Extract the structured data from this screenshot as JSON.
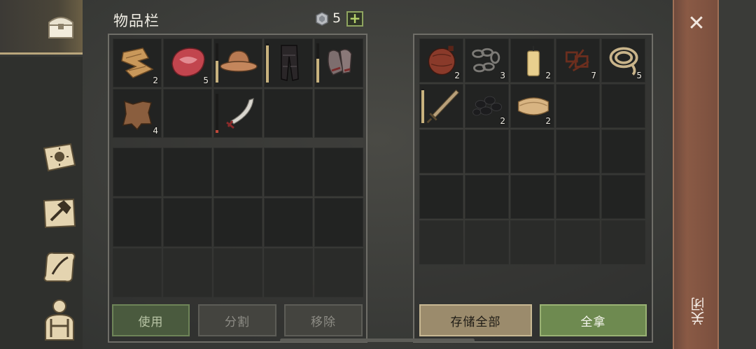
{
  "header": {
    "title": "物品栏",
    "gem_count": "5",
    "plus_label": "+"
  },
  "sidebar": {
    "items": [
      {
        "name": "chest-icon"
      },
      {
        "name": "sun-book-icon"
      },
      {
        "name": "hammer-map-icon"
      },
      {
        "name": "quill-scroll-icon"
      },
      {
        "name": "character-icon"
      }
    ]
  },
  "inventory": {
    "row1": [
      {
        "item": "cloth-scraps",
        "count": "2"
      },
      {
        "item": "raw-meat",
        "count": "5"
      },
      {
        "item": "iron-helmet",
        "count": "",
        "durability": 0.55
      },
      {
        "item": "leather-pants",
        "count": "",
        "durability": 0.95
      },
      {
        "item": "chainmail-gloves",
        "count": "",
        "durability": 0.6
      }
    ],
    "row2": [
      {
        "item": "animal-hide",
        "count": "4"
      },
      {
        "item": "",
        "count": ""
      },
      {
        "item": "scimitar",
        "count": "",
        "durability": 0.08
      },
      {
        "item": "",
        "count": ""
      },
      {
        "item": "",
        "count": ""
      }
    ]
  },
  "storage": {
    "row1": [
      {
        "item": "leather-flask",
        "count": "2"
      },
      {
        "item": "iron-chain",
        "count": "3"
      },
      {
        "item": "candle",
        "count": "2"
      },
      {
        "item": "rusty-scrap",
        "count": "7"
      },
      {
        "item": "rope",
        "count": "5"
      }
    ],
    "row2": [
      {
        "item": "sword",
        "count": "",
        "durability": 0.95
      },
      {
        "item": "coal",
        "count": "2"
      },
      {
        "item": "cloth-bolt",
        "count": "2"
      }
    ]
  },
  "buttons": {
    "use": "使用",
    "split": "分割",
    "remove": "移除",
    "store_all": "存储全部",
    "take_all": "全拿"
  },
  "close": {
    "x": "✕",
    "label": "关闭"
  }
}
